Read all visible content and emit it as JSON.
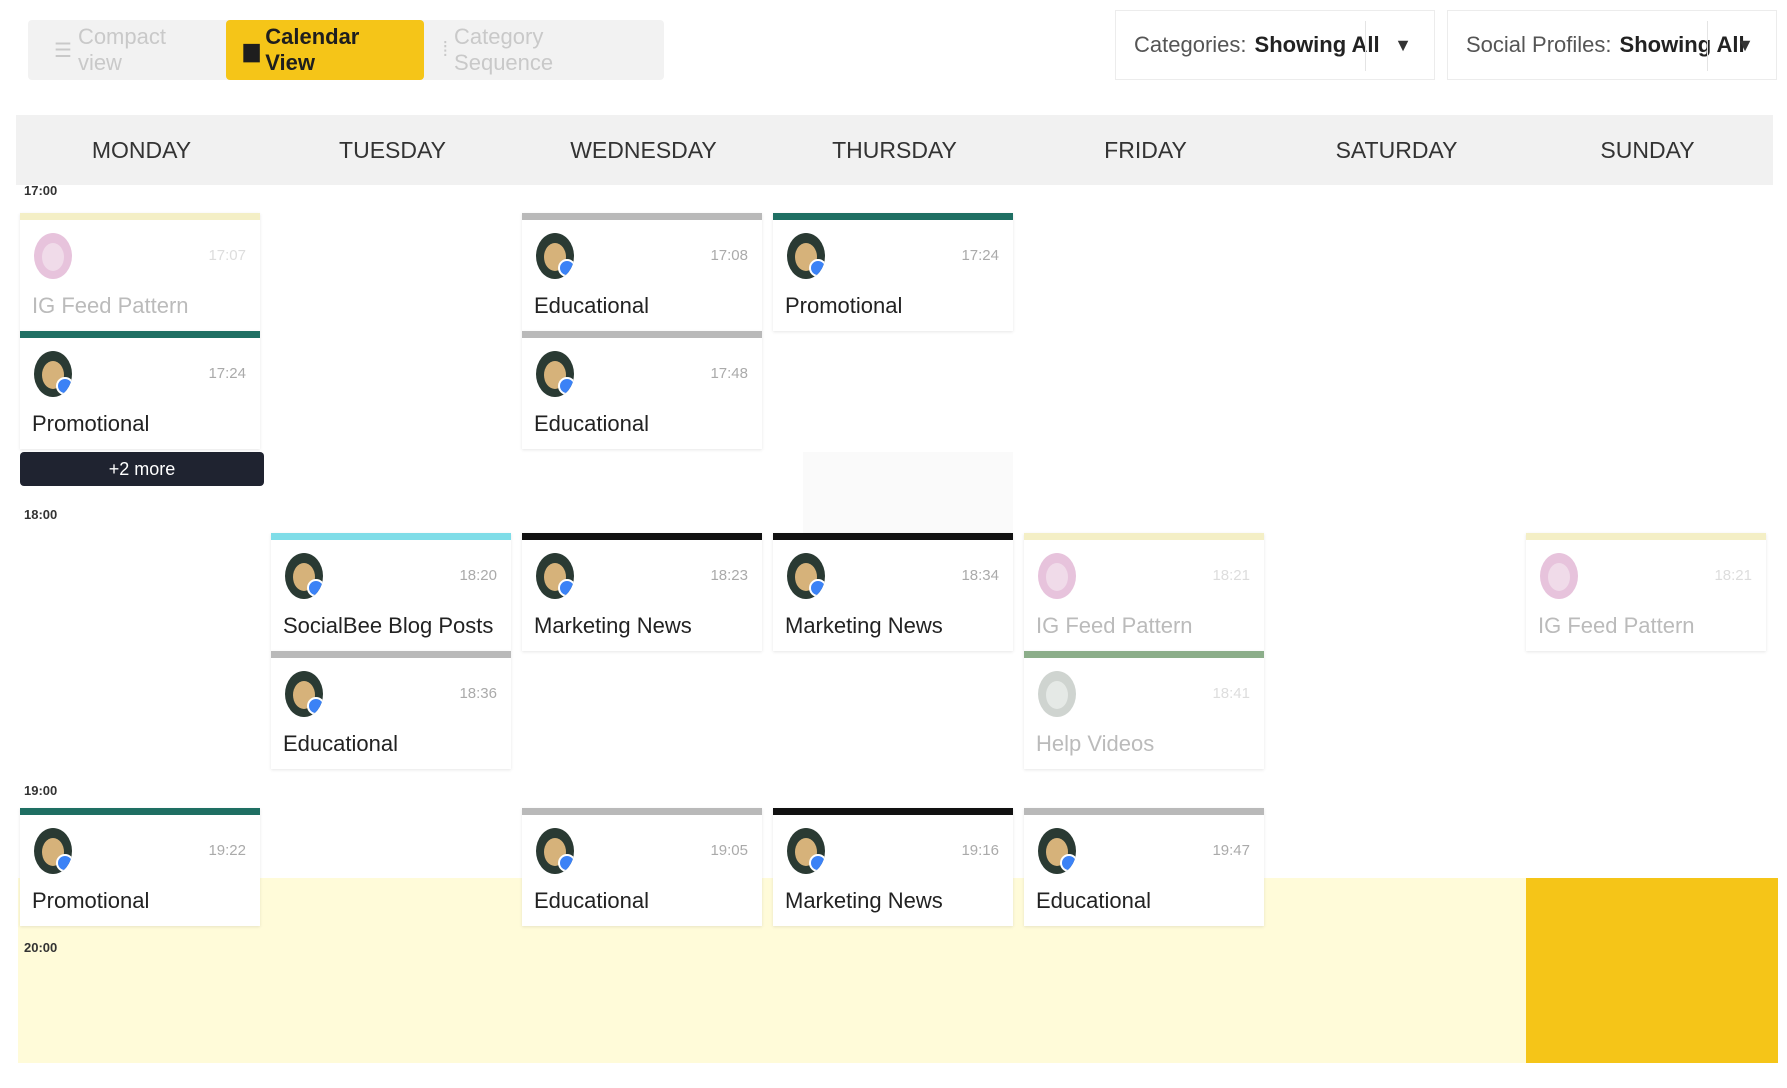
{
  "toolbar": {
    "views": [
      {
        "label": "Compact view",
        "icon": "list-icon"
      },
      {
        "label": "Calendar View",
        "icon": "calendar-icon"
      },
      {
        "label": "Category Sequence",
        "icon": "sequence-icon"
      }
    ],
    "categories_label": "Categories:",
    "categories_value": "Showing All",
    "profiles_label": "Social Profiles:",
    "profiles_value": "Showing All"
  },
  "days": [
    "MONDAY",
    "TUESDAY",
    "WEDNESDAY",
    "THURSDAY",
    "FRIDAY",
    "SATURDAY",
    "SUNDAY"
  ],
  "times": [
    "17:00",
    "18:00",
    "19:00",
    "20:00"
  ],
  "more_label": "+2 more",
  "colors": {
    "accent": "#f5c518",
    "highlight_band": "#fffbd9",
    "more_button": "#1f2330",
    "promotional": "#1f6f63",
    "educational": "#b9b9b9",
    "marketing_news": "#111111",
    "socialbee_blog": "#7fdde8",
    "ig_feed": "#f4efc6",
    "help_videos": "#8cae8a"
  },
  "cards": [
    {
      "day": "MONDAY",
      "time": "17:07",
      "label": "IG Feed Pattern",
      "color": "#f4efc6",
      "style": "faded"
    },
    {
      "day": "MONDAY",
      "time": "17:24",
      "label": "Promotional",
      "color": "#1f6f63",
      "style": "normal"
    },
    {
      "day": "WEDNESDAY",
      "time": "17:08",
      "label": "Educational",
      "color": "#b9b9b9",
      "style": "normal"
    },
    {
      "day": "WEDNESDAY",
      "time": "17:48",
      "label": "Educational",
      "color": "#b9b9b9",
      "style": "normal"
    },
    {
      "day": "THURSDAY",
      "time": "17:24",
      "label": "Promotional",
      "color": "#1f6f63",
      "style": "normal"
    },
    {
      "day": "TUESDAY",
      "time": "18:20",
      "label": "SocialBee Blog Posts",
      "color": "#7fdde8",
      "style": "normal"
    },
    {
      "day": "TUESDAY",
      "time": "18:36",
      "label": "Educational",
      "color": "#b9b9b9",
      "style": "normal"
    },
    {
      "day": "WEDNESDAY",
      "time": "18:23",
      "label": "Marketing News",
      "color": "#111111",
      "style": "normal"
    },
    {
      "day": "THURSDAY",
      "time": "18:34",
      "label": "Marketing News",
      "color": "#111111",
      "style": "normal"
    },
    {
      "day": "FRIDAY",
      "time": "18:21",
      "label": "IG Feed Pattern",
      "color": "#f4efc6",
      "style": "faded"
    },
    {
      "day": "FRIDAY",
      "time": "18:41",
      "label": "Help Videos",
      "color": "#8cae8a",
      "style": "grey"
    },
    {
      "day": "SUNDAY",
      "time": "18:21",
      "label": "IG Feed Pattern",
      "color": "#f4efc6",
      "style": "faded"
    },
    {
      "day": "MONDAY",
      "time": "19:22",
      "label": "Promotional",
      "color": "#1f6f63",
      "style": "normal"
    },
    {
      "day": "WEDNESDAY",
      "time": "19:05",
      "label": "Educational",
      "color": "#b9b9b9",
      "style": "normal"
    },
    {
      "day": "THURSDAY",
      "time": "19:16",
      "label": "Marketing News",
      "color": "#111111",
      "style": "normal"
    },
    {
      "day": "FRIDAY",
      "time": "19:47",
      "label": "Educational",
      "color": "#b9b9b9",
      "style": "normal"
    }
  ]
}
